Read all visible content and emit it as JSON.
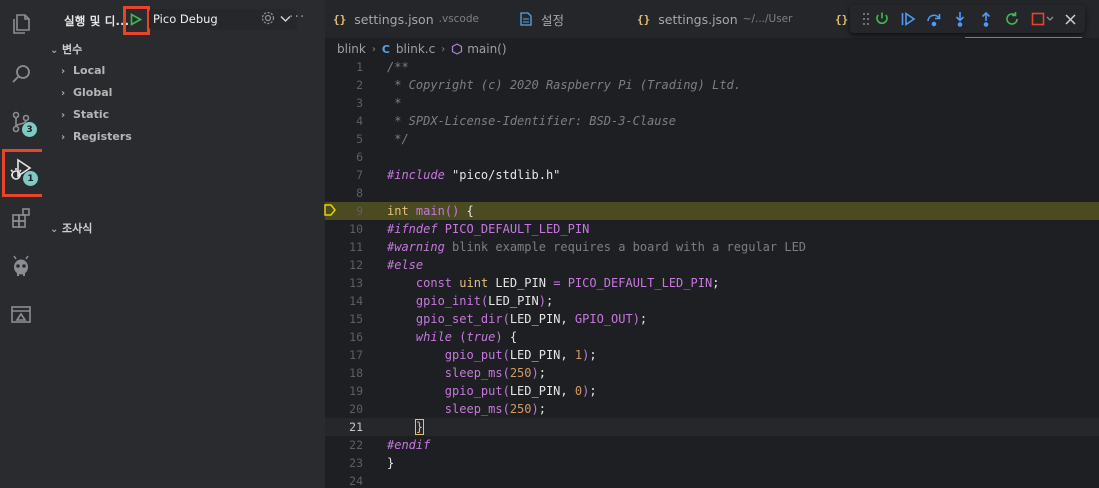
{
  "activity_bar": {
    "items": [
      {
        "name": "explorer",
        "icon": "files-icon"
      },
      {
        "name": "search",
        "icon": "search-icon"
      },
      {
        "name": "source-control",
        "icon": "source-control-icon",
        "badge": "3"
      },
      {
        "name": "run-and-debug",
        "icon": "run-debug-icon",
        "badge": "1",
        "active": true
      },
      {
        "name": "extensions",
        "icon": "extensions-icon"
      },
      {
        "name": "platformio",
        "icon": "alien-icon"
      },
      {
        "name": "remote",
        "icon": "remote-explorer-icon"
      }
    ]
  },
  "sidebar": {
    "title": "실행 및 디...",
    "launch_config": "Pico Debug",
    "sections": {
      "variables": {
        "label": "변수",
        "items": [
          "Local",
          "Global",
          "Static",
          "Registers"
        ]
      },
      "watch": {
        "label": "조사식"
      }
    }
  },
  "tabs": [
    {
      "name": "settings.json",
      "desc": ".vscode",
      "icon": "json-icon"
    },
    {
      "name": "설정",
      "desc": "",
      "icon": "file-icon"
    },
    {
      "name": "settings.json",
      "desc": "~/.../User",
      "icon": "json-icon"
    }
  ],
  "breadcrumb": {
    "folder": "blink",
    "file": "blink.c",
    "symbol": "main()"
  },
  "editor": {
    "debug_line": 9,
    "cursor_line": 21,
    "lines": [
      {
        "n": "1",
        "text": "/**"
      },
      {
        "n": "2",
        "text": " * Copyright (c) 2020 Raspberry Pi (Trading) Ltd."
      },
      {
        "n": "3",
        "text": " *"
      },
      {
        "n": "4",
        "text": " * SPDX-License-Identifier: BSD-3-Clause"
      },
      {
        "n": "5",
        "text": " */"
      },
      {
        "n": "6",
        "text": ""
      },
      {
        "n": "7",
        "text": "#include \"pico/stdlib.h\""
      },
      {
        "n": "8",
        "text": ""
      },
      {
        "n": "9",
        "text": "int main() {"
      },
      {
        "n": "10",
        "text": "#ifndef PICO_DEFAULT_LED_PIN"
      },
      {
        "n": "11",
        "text": "#warning blink example requires a board with a regular LED"
      },
      {
        "n": "12",
        "text": "#else"
      },
      {
        "n": "13",
        "text": "    const uint LED_PIN = PICO_DEFAULT_LED_PIN;"
      },
      {
        "n": "14",
        "text": "    gpio_init(LED_PIN);"
      },
      {
        "n": "15",
        "text": "    gpio_set_dir(LED_PIN, GPIO_OUT);"
      },
      {
        "n": "16",
        "text": "    while (true) {"
      },
      {
        "n": "17",
        "text": "        gpio_put(LED_PIN, 1);"
      },
      {
        "n": "18",
        "text": "        sleep_ms(250);"
      },
      {
        "n": "19",
        "text": "        gpio_put(LED_PIN, 0);"
      },
      {
        "n": "20",
        "text": "        sleep_ms(250);"
      },
      {
        "n": "21",
        "text": "    }"
      },
      {
        "n": "22",
        "text": "#endif"
      },
      {
        "n": "23",
        "text": "}"
      },
      {
        "n": "24",
        "text": ""
      }
    ]
  },
  "debug_toolbar": {
    "buttons": [
      "drag-handle",
      "disconnect",
      "continue",
      "step-over",
      "step-into",
      "step-out",
      "restart",
      "stop"
    ],
    "colors": {
      "green": "#3fb950",
      "blue": "#4d9cf5",
      "red": "#e8442a"
    }
  },
  "colors": {
    "highlight_box": "#e8442a",
    "badge": "#7fc8c3",
    "debug_line_bg": "#4a4b21"
  }
}
